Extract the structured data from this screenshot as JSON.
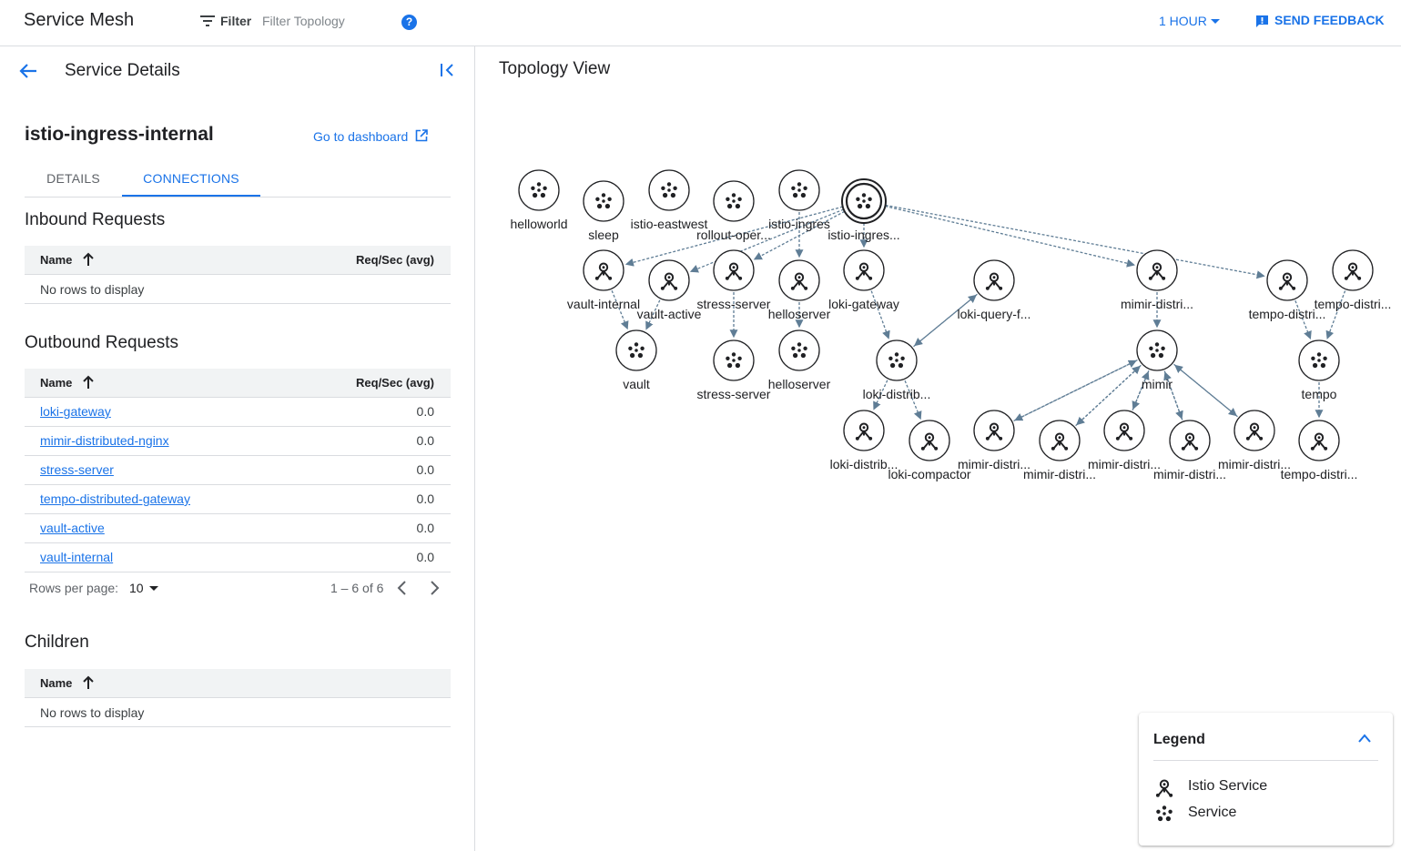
{
  "topbar": {
    "title": "Service Mesh",
    "filter_label": "Filter",
    "filter_placeholder": "Filter Topology",
    "help_icon": "help-circle-icon",
    "time_range": "1 HOUR",
    "feedback_label": "SEND FEEDBACK"
  },
  "panel": {
    "title": "Service Details",
    "service_name": "istio-ingress-internal",
    "dashboard_link": "Go to dashboard",
    "tabs": [
      "DETAILS",
      "CONNECTIONS"
    ],
    "active_tab": "CONNECTIONS"
  },
  "inbound": {
    "title": "Inbound Requests",
    "columns": [
      "Name",
      "Req/Sec (avg)"
    ],
    "empty_text": "No rows to display"
  },
  "outbound": {
    "title": "Outbound Requests",
    "columns": [
      "Name",
      "Req/Sec (avg)"
    ],
    "rows": [
      {
        "name": "loki-gateway",
        "value": "0.0"
      },
      {
        "name": "mimir-distributed-nginx",
        "value": "0.0"
      },
      {
        "name": "stress-server",
        "value": "0.0"
      },
      {
        "name": "tempo-distributed-gateway",
        "value": "0.0"
      },
      {
        "name": "vault-active",
        "value": "0.0"
      },
      {
        "name": "vault-internal",
        "value": "0.0"
      }
    ],
    "pagination": {
      "rows_per_page_label": "Rows per page:",
      "rows_per_page": "10",
      "range": "1 – 6 of 6"
    }
  },
  "children": {
    "title": "Children",
    "columns": [
      "Name"
    ],
    "empty_text": "No rows to display"
  },
  "topology": {
    "title": "Topology View",
    "nodes": [
      {
        "id": "helloworld",
        "label": "helloworld",
        "kind": "service"
      },
      {
        "id": "sleep",
        "label": "sleep",
        "kind": "service"
      },
      {
        "id": "istio-eastwest",
        "label": "istio-eastwest",
        "kind": "service"
      },
      {
        "id": "rollout-oper",
        "label": "rollout-oper...",
        "kind": "service"
      },
      {
        "id": "istio-ingres",
        "label": "istio-ingres",
        "kind": "service"
      },
      {
        "id": "istio-ingres-internal",
        "label": "istio-ingres...",
        "kind": "service",
        "selected": true
      },
      {
        "id": "vault-internal",
        "label": "vault-internal",
        "kind": "istio"
      },
      {
        "id": "vault-active",
        "label": "vault-active",
        "kind": "istio"
      },
      {
        "id": "stress-server-istio",
        "label": "stress-server",
        "kind": "istio"
      },
      {
        "id": "helloserver-istio",
        "label": "helloserver",
        "kind": "istio"
      },
      {
        "id": "loki-gateway",
        "label": "loki-gateway",
        "kind": "istio"
      },
      {
        "id": "loki-query-f",
        "label": "loki-query-f...",
        "kind": "istio"
      },
      {
        "id": "mimir-distri-top",
        "label": "mimir-distri...",
        "kind": "istio"
      },
      {
        "id": "tempo-distri-a",
        "label": "tempo-distri...",
        "kind": "istio"
      },
      {
        "id": "tempo-distri-b",
        "label": "tempo-distri...",
        "kind": "istio"
      },
      {
        "id": "vault",
        "label": "vault",
        "kind": "service"
      },
      {
        "id": "stress-server",
        "label": "stress-server",
        "kind": "service"
      },
      {
        "id": "helloserver",
        "label": "helloserver",
        "kind": "service"
      },
      {
        "id": "loki-distrib-svc",
        "label": "loki-distrib...",
        "kind": "service"
      },
      {
        "id": "mimir",
        "label": "mimir",
        "kind": "service"
      },
      {
        "id": "tempo",
        "label": "tempo",
        "kind": "service"
      },
      {
        "id": "loki-distrib-istio",
        "label": "loki-distrib...",
        "kind": "istio"
      },
      {
        "id": "loki-compactor",
        "label": "loki-compactor",
        "kind": "istio"
      },
      {
        "id": "mimir-distri-1",
        "label": "mimir-distri...",
        "kind": "istio"
      },
      {
        "id": "mimir-distri-2",
        "label": "mimir-distri...",
        "kind": "istio"
      },
      {
        "id": "mimir-distri-3",
        "label": "mimir-distri...",
        "kind": "istio"
      },
      {
        "id": "mimir-distri-4",
        "label": "mimir-distri...",
        "kind": "istio"
      },
      {
        "id": "mimir-distri-5",
        "label": "mimir-distri...",
        "kind": "istio"
      },
      {
        "id": "tempo-distri-c",
        "label": "tempo-distri...",
        "kind": "istio"
      }
    ],
    "edges": [
      [
        "istio-ingres-internal",
        "vault-internal"
      ],
      [
        "istio-ingres-internal",
        "vault-active"
      ],
      [
        "istio-ingres-internal",
        "stress-server-istio"
      ],
      [
        "istio-ingres-internal",
        "loki-gateway"
      ],
      [
        "istio-ingres-internal",
        "mimir-distri-top"
      ],
      [
        "istio-ingres-internal",
        "tempo-distri-a"
      ],
      [
        "istio-ingres",
        "helloserver-istio"
      ],
      [
        "vault-internal",
        "vault"
      ],
      [
        "vault-active",
        "vault"
      ],
      [
        "stress-server-istio",
        "stress-server"
      ],
      [
        "helloserver-istio",
        "helloserver"
      ],
      [
        "loki-gateway",
        "loki-distrib-svc"
      ],
      [
        "loki-query-f",
        "loki-distrib-svc"
      ],
      [
        "loki-distrib-svc",
        "loki-query-f"
      ],
      [
        "loki-distrib-svc",
        "loki-distrib-istio"
      ],
      [
        "loki-distrib-svc",
        "loki-compactor"
      ],
      [
        "mimir-distri-top",
        "mimir"
      ],
      [
        "mimir",
        "mimir-distri-1"
      ],
      [
        "mimir",
        "mimir-distri-2"
      ],
      [
        "mimir",
        "mimir-distri-3"
      ],
      [
        "mimir",
        "mimir-distri-4"
      ],
      [
        "mimir",
        "mimir-distri-5"
      ],
      [
        "mimir-distri-1",
        "mimir"
      ],
      [
        "mimir-distri-2",
        "mimir"
      ],
      [
        "mimir-distri-3",
        "mimir"
      ],
      [
        "mimir-distri-4",
        "mimir"
      ],
      [
        "mimir-distri-5",
        "mimir"
      ],
      [
        "tempo-distri-a",
        "tempo"
      ],
      [
        "tempo-distri-b",
        "tempo"
      ],
      [
        "tempo",
        "tempo-distri-c"
      ]
    ]
  },
  "legend": {
    "title": "Legend",
    "items": [
      {
        "label": "Istio Service",
        "icon": "istio-service-icon"
      },
      {
        "label": "Service",
        "icon": "service-icon"
      }
    ]
  },
  "colors": {
    "accent": "#1a73e8",
    "edge": "#5f7d95",
    "border": "#dadce0"
  }
}
